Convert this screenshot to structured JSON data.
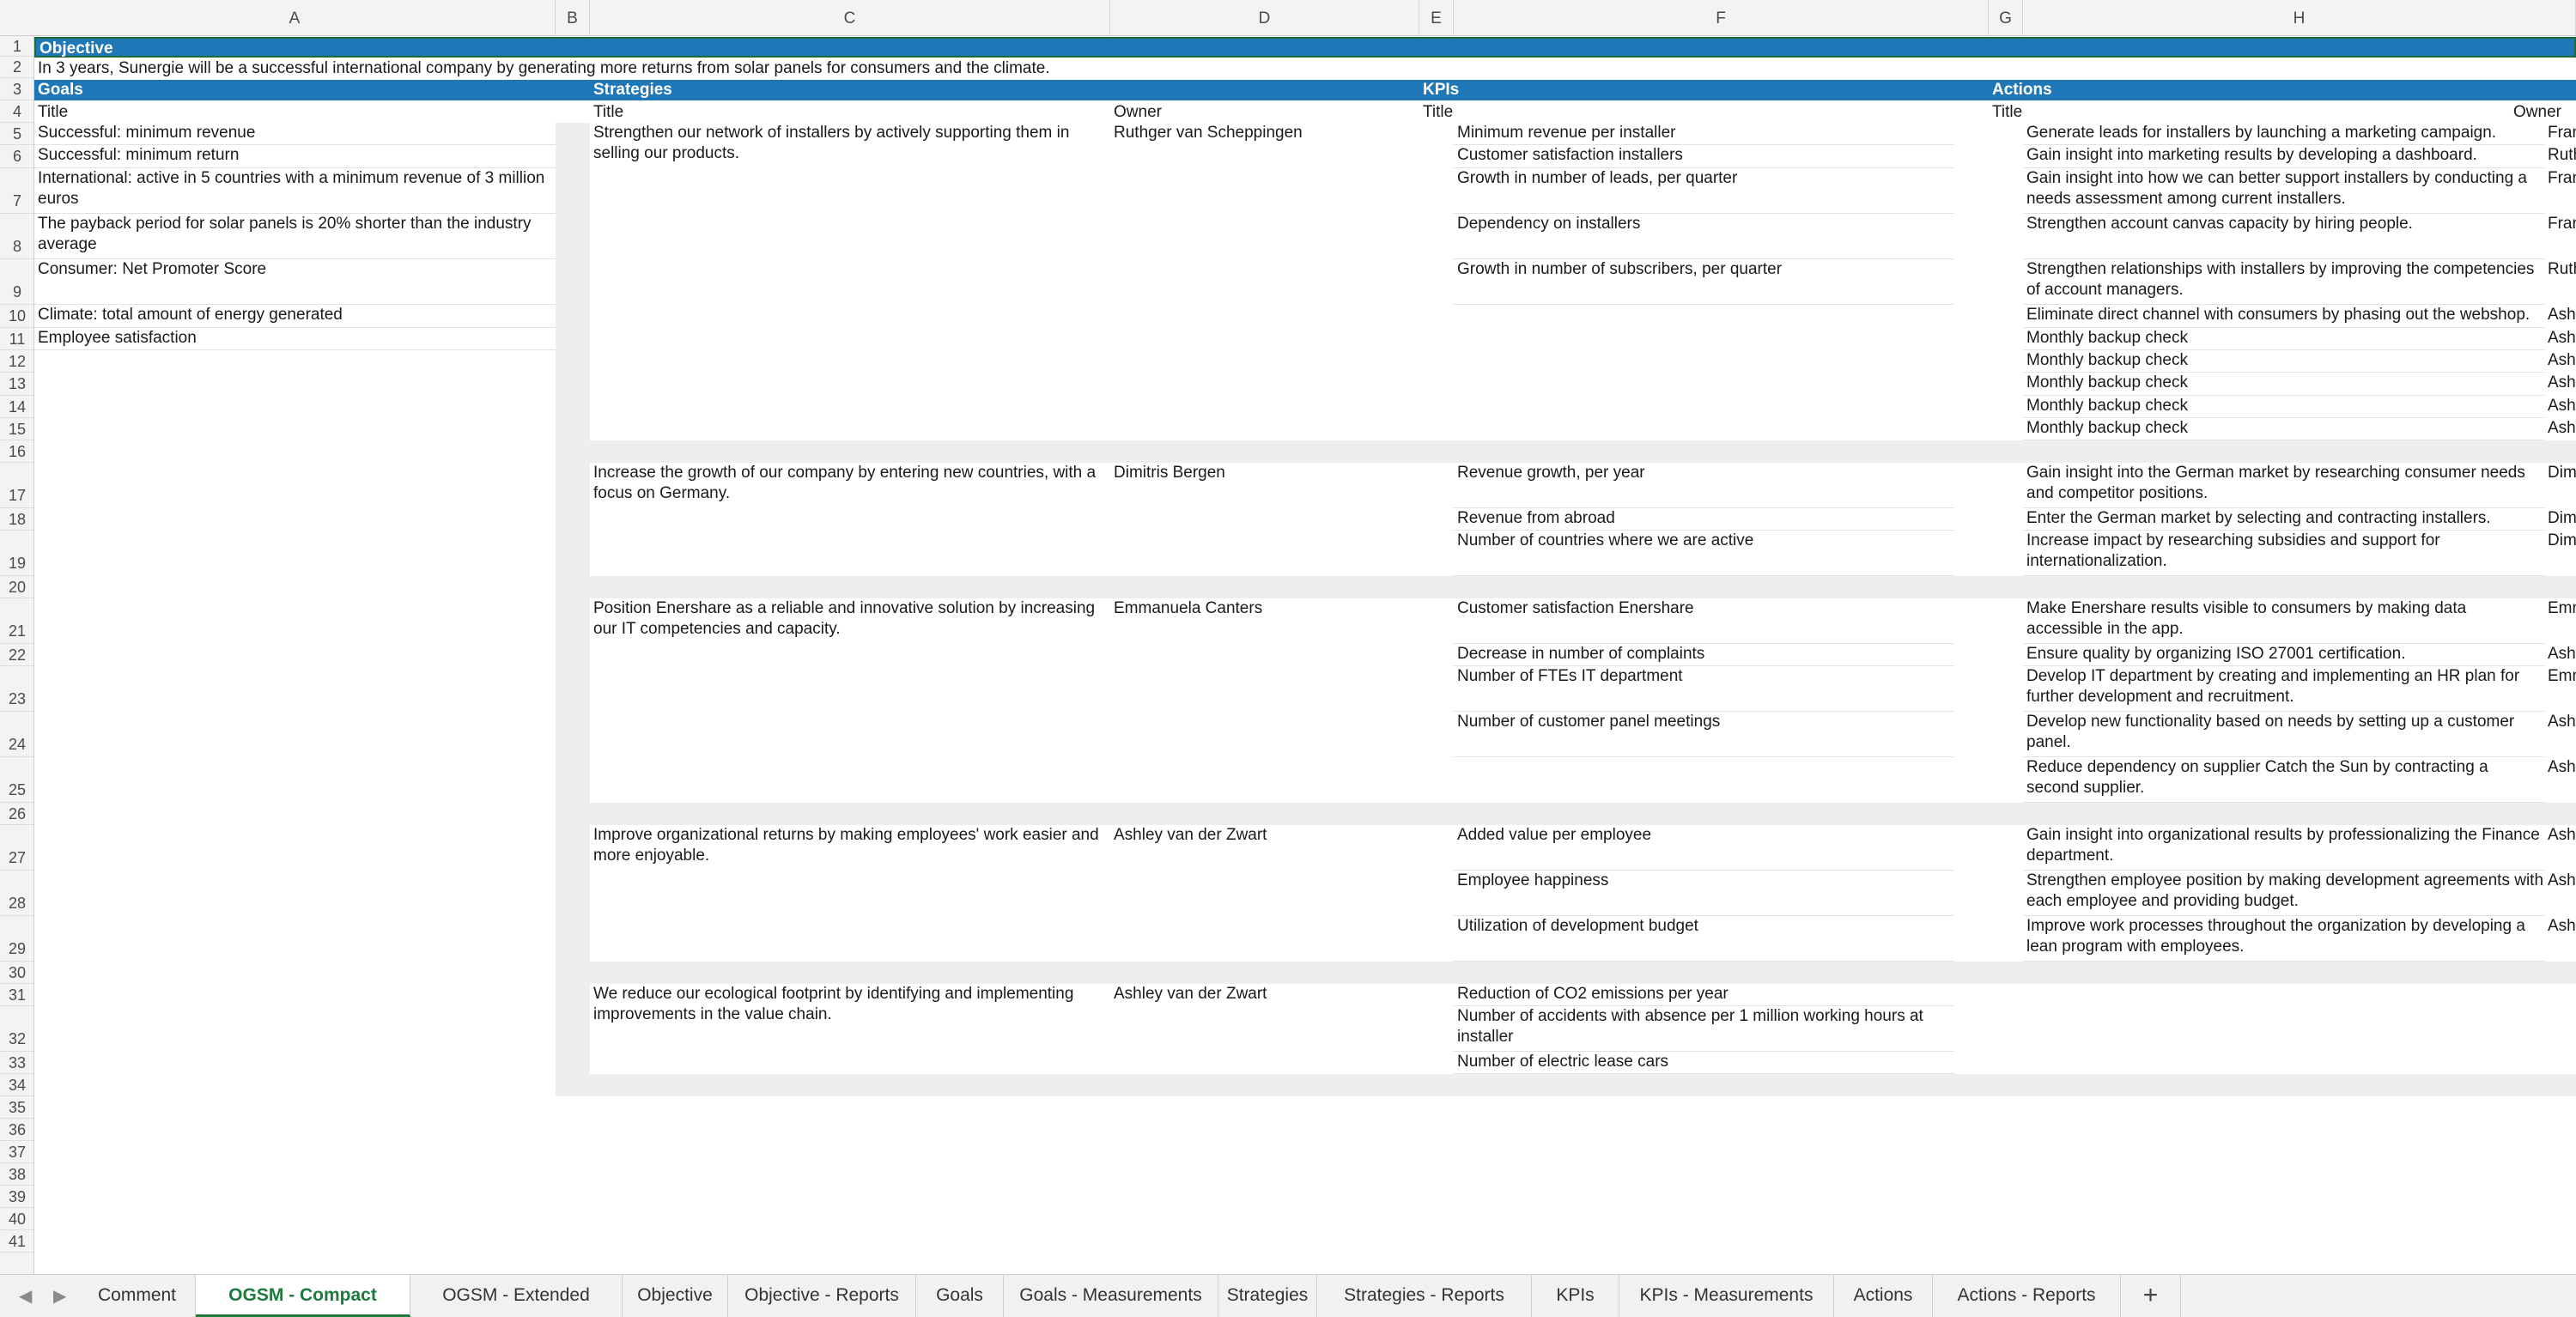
{
  "columns": [
    "A",
    "B",
    "C",
    "D",
    "E",
    "F",
    "G",
    "H"
  ],
  "rows": [
    "1",
    "2",
    "3",
    "4",
    "5",
    "6",
    "7",
    "8",
    "9",
    "10",
    "11",
    "12",
    "13",
    "14",
    "15",
    "16",
    "17",
    "18",
    "19",
    "20",
    "21",
    "22",
    "23",
    "24",
    "25",
    "26",
    "27",
    "28",
    "29",
    "30",
    "31",
    "32",
    "33",
    "34",
    "35",
    "36",
    "37",
    "38",
    "39",
    "40",
    "41"
  ],
  "objective": {
    "label": "Objective",
    "text": "In 3 years, Sunergie will be a successful international company by generating more returns from solar panels for consumers and the climate."
  },
  "headers": {
    "goals": "Goals",
    "strategies": "Strategies",
    "kpis": "KPIs",
    "actions": "Actions"
  },
  "subheaders": {
    "title": "Title",
    "owner": "Owner"
  },
  "goals": [
    "Successful: minimum revenue",
    "Successful: minimum return",
    "International: active in 5 countries with a minimum revenue of 3 million euros",
    "The payback period for solar panels is 20% shorter than the industry average",
    "Consumer: Net Promoter Score",
    "Climate: total amount of energy generated",
    "Employee satisfaction"
  ],
  "strategies": [
    {
      "title": "Strengthen our network of installers by actively supporting them in selling our products.",
      "owner": "Ruthger van Scheppingen",
      "kpis": [
        "Minimum revenue per installer",
        "Customer satisfaction installers",
        "Growth in number of leads, per quarter",
        "Dependency on installers",
        "Growth in number of subscribers, per quarter"
      ],
      "actions": [
        {
          "title": "Generate leads for installers by launching a marketing campaign.",
          "owner": "Franklin"
        },
        {
          "title": "Gain insight into marketing results by developing a dashboard.",
          "owner": "Ruthger"
        },
        {
          "title": "Gain insight into how we can better support installers by conducting a needs assessment among current installers.",
          "owner": "Franklin"
        },
        {
          "title": "Strengthen account canvas capacity by hiring people.",
          "owner": "Franklin"
        },
        {
          "title": "Strengthen relationships with installers by improving the competencies of account managers.",
          "owner": "Ruthger"
        },
        {
          "title": "Eliminate direct channel with consumers by phasing out the webshop.",
          "owner": "Ashley v"
        },
        {
          "title": "Monthly backup check",
          "owner": "Ashley v"
        },
        {
          "title": "Monthly backup check",
          "owner": "Ashley v"
        },
        {
          "title": "Monthly backup check",
          "owner": "Ashley v"
        },
        {
          "title": "Monthly backup check",
          "owner": "Ashley v"
        },
        {
          "title": "Monthly backup check",
          "owner": "Ashley v"
        }
      ]
    },
    {
      "title": "Increase the growth of our company by entering new countries, with a focus on Germany.",
      "owner": "Dimitris Bergen",
      "kpis": [
        "Revenue growth, per year",
        "Revenue from abroad",
        "Number of countries where we are active"
      ],
      "actions": [
        {
          "title": "Gain insight into the German market by researching consumer needs and competitor positions.",
          "owner": "Dimitris"
        },
        {
          "title": "Enter the German market by selecting and contracting installers.",
          "owner": "Dimitris"
        },
        {
          "title": "Increase impact by researching subsidies and support for internationalization.",
          "owner": "Dimitris"
        }
      ]
    },
    {
      "title": "Position Enershare as a reliable and innovative solution by increasing our IT competencies and capacity.",
      "owner": "Emmanuela Canters",
      "kpis": [
        "Customer satisfaction Enershare",
        "Decrease in number of complaints",
        "Number of FTEs IT department",
        "Number of customer panel meetings"
      ],
      "actions": [
        {
          "title": "Make Enershare results visible to consumers by making data accessible in the app.",
          "owner": "Emmanu"
        },
        {
          "title": "Ensure quality by organizing ISO 27001 certification.",
          "owner": "Ashley v"
        },
        {
          "title": "Develop IT department by creating and implementing an HR plan for further development and recruitment.",
          "owner": "Emmanu"
        },
        {
          "title": "Develop new functionality based on needs by setting up a customer panel.",
          "owner": "Ashley v"
        },
        {
          "title": "Reduce dependency on supplier Catch the Sun by contracting a second supplier.",
          "owner": "Ashley v"
        }
      ]
    },
    {
      "title": "Improve organizational returns by making employees' work easier and more enjoyable.",
      "owner": "Ashley van der Zwart",
      "kpis": [
        "Added value per employee",
        "Employee happiness",
        "Utilization of development budget"
      ],
      "actions": [
        {
          "title": "Gain insight into organizational results by professionalizing the Finance department.",
          "owner": "Ashley v"
        },
        {
          "title": "Strengthen employee position by making development agreements with each employee and providing budget.",
          "owner": "Ashley v"
        },
        {
          "title": "Improve work processes throughout the organization by developing a lean program with employees.",
          "owner": "Ashley v"
        }
      ]
    },
    {
      "title": "We reduce our ecological footprint by identifying and implementing improvements in the value chain.",
      "owner": "Ashley van der Zwart",
      "kpis": [
        "Reduction of CO2 emissions per year",
        "Number of accidents with absence per 1 million working hours at installer",
        "Number of electric lease cars"
      ],
      "actions": []
    }
  ],
  "tabs": [
    {
      "label": "Comment",
      "active": false
    },
    {
      "label": "OGSM - Compact",
      "active": true
    },
    {
      "label": "OGSM - Extended",
      "active": false
    },
    {
      "label": "Objective",
      "active": false
    },
    {
      "label": "Objective - Reports",
      "active": false
    },
    {
      "label": "Goals",
      "active": false
    },
    {
      "label": "Goals - Measurements",
      "active": false
    },
    {
      "label": "Strategies",
      "active": false
    },
    {
      "label": "Strategies - Reports",
      "active": false
    },
    {
      "label": "KPIs",
      "active": false
    },
    {
      "label": "KPIs - Measurements",
      "active": false
    },
    {
      "label": "Actions",
      "active": false
    },
    {
      "label": "Actions - Reports",
      "active": false
    }
  ],
  "add_tab_label": "+",
  "nav": {
    "prev": "◀",
    "next": "▶"
  },
  "colors": {
    "header_blue": "#1f77b8",
    "active_tab_green": "#1e7a3c",
    "band_grey": "#eeeeee"
  }
}
